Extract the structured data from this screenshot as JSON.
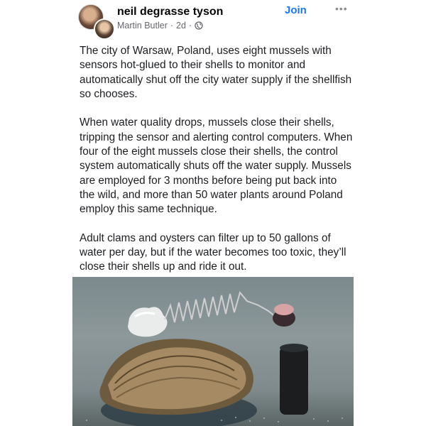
{
  "post": {
    "author": "neil degrasse tyson",
    "poster": "Martin Butler",
    "separator": "·",
    "time": "2d",
    "separator2": "·",
    "visibility_icon": "globe-icon",
    "join_label": "Join",
    "more_icon": "more-options-icon",
    "more_glyph": "•••",
    "paragraphs": [
      "The city of Warsaw, Poland, uses eight mussels with sensors hot-glued to their shells to monitor and automatically shut off the city water supply if the shellfish so chooses.",
      "When water quality drops, mussels close their shells, tripping the sensor and alerting control computers. When four of the eight mussels close their shells, the control system automatically shuts off the water supply. Mussels are employed for 3 months before being put back into the wild, and more than 50 water plants around Poland employ this same technique.",
      "Adult clams and oysters can filter up to 50 gallons of water per day, but if the water becomes too toxic, they’ll close their shells up and ride it out."
    ]
  },
  "colors": {
    "join": "#1877f2",
    "meta": "#65676b",
    "text": "#1c1e21"
  }
}
